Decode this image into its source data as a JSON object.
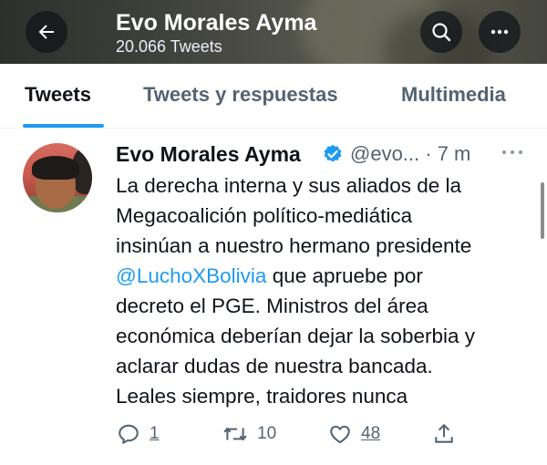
{
  "header": {
    "title": "Evo Morales Ayma",
    "subtitle": "20.066 Tweets",
    "back_icon": "arrow-left-icon",
    "search_icon": "search-icon",
    "more_icon": "more-horizontal-icon"
  },
  "tabs": [
    {
      "label": "Tweets",
      "active": true
    },
    {
      "label": "Tweets y respuestas",
      "active": false
    },
    {
      "label": "Multimedia",
      "active": false
    }
  ],
  "tweet": {
    "author_name": "Evo Morales Ayma",
    "handle_time": "@evo... · 7 m",
    "lines": [
      "La derecha interna y sus aliados de la",
      "Megacoalición político-mediática",
      "insinúan a nuestro hermano presidente",
      "que apruebe por",
      "decreto el PGE. Ministros del área",
      "económica deberían dejar la soberbia y",
      "aclarar dudas de nuestra bancada.",
      "Leales siempre, traidores nunca"
    ],
    "mention": "@LuchoXBolivia",
    "actions": {
      "replies": "1",
      "retweets": "10",
      "likes": "48"
    }
  },
  "colors": {
    "accent": "#1d9bf0",
    "text": "#0f1419",
    "muted": "#536471"
  }
}
